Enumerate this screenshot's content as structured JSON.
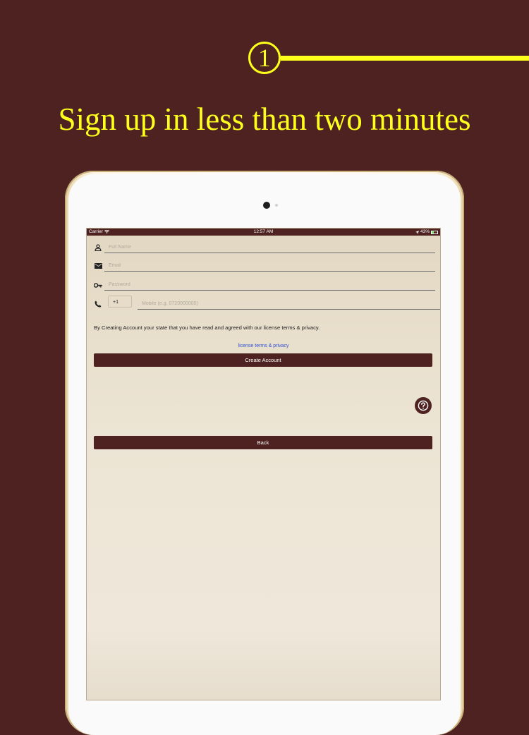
{
  "step": {
    "number": "1"
  },
  "headline": "Sign up in less than two minutes",
  "status_bar": {
    "carrier": "Carrier",
    "time": "12:57 AM",
    "battery": "43%",
    "battery_level": 0.43
  },
  "form": {
    "full_name": {
      "placeholder": "Full Name",
      "value": ""
    },
    "email": {
      "placeholder": "Email",
      "value": ""
    },
    "password": {
      "placeholder": "Password",
      "value": ""
    },
    "phone": {
      "country_code": "+1",
      "placeholder": "Mobile (e.g. 0720000000)",
      "value": ""
    }
  },
  "terms": {
    "text": "By Creating Account your state that you have read and agreed with our license terms & privacy.",
    "link": "license terms & privacy"
  },
  "buttons": {
    "create_account": "Create Account",
    "back": "Back"
  },
  "icons": [
    "person-icon",
    "envelope-icon",
    "key-icon",
    "phone-icon",
    "help-icon",
    "wifi-icon",
    "location-arrow-icon",
    "battery-icon"
  ],
  "colors": {
    "background": "#4e2221",
    "accent": "#ffff1e",
    "button": "#4e2221",
    "link": "#2f50d0"
  }
}
